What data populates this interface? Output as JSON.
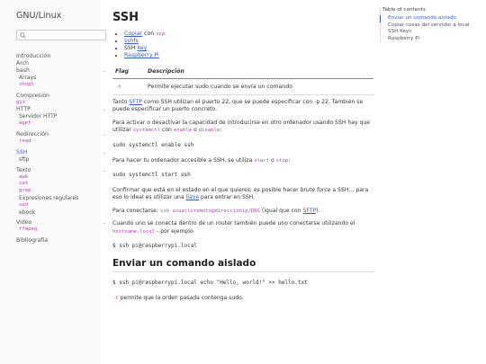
{
  "sidebar": {
    "title": "GNU/Linux",
    "search_placeholder": "",
    "introduccion": "Introducción",
    "arch": "Arch",
    "bash": "bash",
    "bash_items": [
      "Arrays",
      "shopt"
    ],
    "compresion": "Compresión",
    "git": "git",
    "http": "HTTP",
    "http_items": [
      "Servidor HTTP",
      "wget"
    ],
    "redireccion": "Redirección",
    "redireccion_items": [
      "read"
    ],
    "ssh": "SSH",
    "ssh_items": [
      "sftp"
    ],
    "texto": "Texto",
    "texto_items": [
      "awk",
      "cat",
      "grep",
      "Expresiones regulares",
      "sed",
      "ebook"
    ],
    "video": "Video",
    "video_items": [
      "ffmpeg"
    ],
    "bibliografia": "Bibliografía"
  },
  "content": {
    "title": "SSH",
    "links": {
      "copiar": "Copiar",
      "con": " con ",
      "scp": "scp",
      "sshfs": "sshfs",
      "ssh_pre": "SSH ",
      "key": "key",
      "raspberry": "Raspberry Pi"
    },
    "table": {
      "col_flag": "Flag",
      "col_desc": "Descripción",
      "row_flag": "-t",
      "row_desc": "Permite ejecutar sudo cuando se envía un comando"
    },
    "p1_a": "Tanto ",
    "p1_sftp": "SFTP",
    "p1_b": " como SSH utilizan el puerto 22, que se puede especificar con -p 22. También se puede especificar un puerto concreto.",
    "p2_a": "Para activar o desactivar la capacidad de introducirse en otro ordenador usando SSH hay que utilizar ",
    "p2_code1": "systemctl",
    "p2_b": " con ",
    "p2_code2": "enable",
    "p2_c": " o ",
    "p2_code3": "disable",
    "p2_d": ":",
    "pre1": "sudo systemctl enable ssh",
    "p3_a": "Para hacer tu ordenador accesible a SSH, se utiliza ",
    "p3_code1": "start",
    "p3_b": " o ",
    "p3_code2": "stop",
    "p3_c": ":",
    "pre2": "sudo systemctl start ssh",
    "p4_a": "Confirmar que está en el estado en el que quieres; es posible hacer ",
    "p4_em": "brute force",
    "p4_b": " a SSH… para eso lo ideal es utilizar una ",
    "p4_link": "llave",
    "p4_c": " para entrar en SSH.",
    "p5_a": "Para conectarse: ",
    "p5_code": "ssh usuarioremoto@direcciónip/DNS",
    "p5_b": " (igual que con ",
    "p5_link": "SFTP",
    "p5_c": ").",
    "p6_a": "Cuando uno se conecta dentro de un router también puede uno conectarse utilizando el ",
    "p6_code": "hostname.local",
    "p6_b": " - por ejemplo",
    "pre3": "$ ssh pi@raspberrypi.local",
    "h2": "Enviar un comando aislado",
    "pre4": "$ ssh pi@raspberrypi.local echo \"Hello, world!\" >> hello.txt",
    "p7_code": "-t",
    "p7_b": " permite que la orden pasada contenga sudo."
  },
  "toc": {
    "title": "Table of contents",
    "items": [
      "Enviar un comando aislado",
      "Copiar cosas del servidor a local",
      "SSH Keys",
      "Raspberry Pi"
    ]
  },
  "colors": {
    "accent": "#3a5fc0",
    "code": "#b73fb3"
  }
}
